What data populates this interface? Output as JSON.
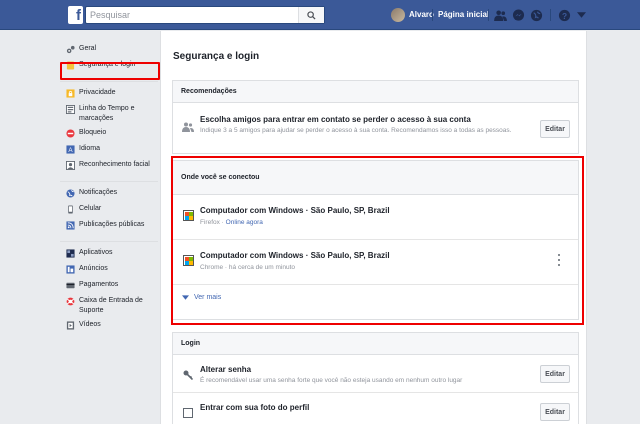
{
  "topbar": {
    "logo": "f",
    "search_placeholder": "Pesquisar",
    "user_name": "Alvaro",
    "home_label": "Página inicial",
    "icons": [
      "friend-requests-icon",
      "messages-icon",
      "notifications-icon",
      "help-icon",
      "account-menu-icon"
    ]
  },
  "colors": {
    "brand": "#3b5998",
    "link": "#4267b2",
    "highlight": "#e00000"
  },
  "leftnav": {
    "group1": [
      {
        "label": "Geral",
        "icon": "gear-icon"
      },
      {
        "label": "Segurança e login",
        "icon": "shield-icon",
        "active": true
      }
    ],
    "group2": [
      {
        "label": "Privacidade",
        "icon": "lock-icon"
      },
      {
        "label": "Linha do Tempo e marcações",
        "icon": "timeline-icon"
      },
      {
        "label": "Bloqueio",
        "icon": "block-icon"
      },
      {
        "label": "Idioma",
        "icon": "language-icon"
      },
      {
        "label": "Reconhecimento facial",
        "icon": "face-icon"
      }
    ],
    "group3": [
      {
        "label": "Notificações",
        "icon": "globe-icon"
      },
      {
        "label": "Celular",
        "icon": "mobile-icon"
      },
      {
        "label": "Publicações públicas",
        "icon": "rss-icon"
      }
    ],
    "group4": [
      {
        "label": "Aplicativos",
        "icon": "apps-icon"
      },
      {
        "label": "Anúncios",
        "icon": "ads-icon"
      },
      {
        "label": "Pagamentos",
        "icon": "card-icon"
      },
      {
        "label": "Caixa de Entrada de Suporte",
        "icon": "lifebuoy-icon"
      },
      {
        "label": "Vídeos",
        "icon": "video-icon"
      }
    ]
  },
  "main": {
    "title": "Segurança e login",
    "recommendations": {
      "header": "Recomendações",
      "title": "Escolha amigos para entrar em contato se perder o acesso à sua conta",
      "subtitle": "Indique 3 a 5 amigos para ajudar se perder o acesso à sua conta. Recomendamos isso a todas as pessoas.",
      "button": "Editar"
    },
    "where_logged_in": {
      "header": "Onde você se conectou",
      "sessions": [
        {
          "device": "Computador com Windows · São Paulo, SP, Brazil",
          "browser": "Firefox",
          "sep": " · ",
          "status": "Online agora"
        },
        {
          "device": "Computador com Windows · São Paulo, SP, Brazil",
          "browser": "Chrome",
          "sep": " · ",
          "status": "há cerca de um minuto"
        }
      ],
      "see_more": "Ver mais"
    },
    "login": {
      "header": "Login",
      "change_password": {
        "title": "Alterar senha",
        "subtitle": "É recomendável usar uma senha forte que você não esteja usando em nenhum outro lugar",
        "button": "Editar"
      },
      "profile_photo": {
        "title": "Entrar com sua foto do perfil",
        "button": "Editar"
      }
    }
  }
}
